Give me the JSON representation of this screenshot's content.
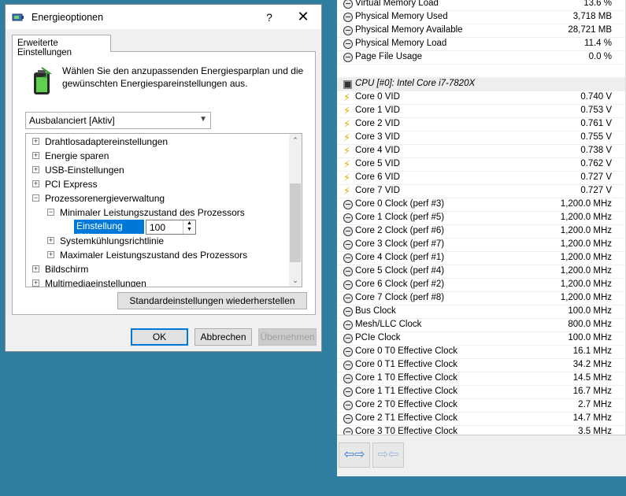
{
  "dialog": {
    "title": "Energieoptionen",
    "help_glyph": "?",
    "close_glyph": "✕",
    "tab_label": "Erweiterte Einstellungen",
    "description": "Wählen Sie den anzupassenden Energiesparplan und die gewünschten Energiespareinstellungen aus.",
    "plan_selected": "Ausbalanciert [Aktiv]",
    "tree": {
      "items": [
        {
          "label": "Drahtlosadaptereinstellungen",
          "expander": "+"
        },
        {
          "label": "Energie sparen",
          "expander": "+"
        },
        {
          "label": "USB-Einstellungen",
          "expander": "+"
        },
        {
          "label": "PCI Express",
          "expander": "+"
        },
        {
          "label": "Prozessorenergieverwaltung",
          "expander": "−"
        },
        {
          "label": "Minimaler Leistungszustand des Prozessors",
          "expander": "−"
        },
        {
          "label": "Systemkühlungsrichtlinie",
          "expander": "+"
        },
        {
          "label": "Maximaler Leistungszustand des Prozessors",
          "expander": "+"
        },
        {
          "label": "Bildschirm",
          "expander": "+"
        },
        {
          "label": "Multimediaeinstellungen",
          "expander": "+"
        }
      ],
      "setting_label": "Einstellung (%):",
      "setting_value": "100"
    },
    "restore_button": "Standardeinstellungen wiederherstellen",
    "ok_button": "OK",
    "cancel_button": "Abbrechen",
    "apply_button": "Übernehmen"
  },
  "sensors": {
    "rows": [
      {
        "icon": "clock",
        "name": "Virtual Memory Load",
        "value": "13.6 %"
      },
      {
        "icon": "clock",
        "name": "Physical Memory Used",
        "value": "3,718 MB"
      },
      {
        "icon": "clock",
        "name": "Physical Memory Available",
        "value": "28,721 MB"
      },
      {
        "icon": "clock",
        "name": "Physical Memory Load",
        "value": "11.4 %"
      },
      {
        "icon": "clock",
        "name": "Page File Usage",
        "value": "0.0 %"
      },
      {
        "icon": "blank",
        "name": "",
        "value": ""
      },
      {
        "icon": "cpu",
        "name": "CPU [#0]: Intel Core i7-7820X",
        "value": ""
      },
      {
        "icon": "volt",
        "name": "Core 0 VID",
        "value": "0.740 V"
      },
      {
        "icon": "volt",
        "name": "Core 1 VID",
        "value": "0.753 V"
      },
      {
        "icon": "volt",
        "name": "Core 2 VID",
        "value": "0.761 V"
      },
      {
        "icon": "volt",
        "name": "Core 3 VID",
        "value": "0.755 V"
      },
      {
        "icon": "volt",
        "name": "Core 4 VID",
        "value": "0.738 V"
      },
      {
        "icon": "volt",
        "name": "Core 5 VID",
        "value": "0.762 V"
      },
      {
        "icon": "volt",
        "name": "Core 6 VID",
        "value": "0.727 V"
      },
      {
        "icon": "volt",
        "name": "Core 7 VID",
        "value": "0.727 V"
      },
      {
        "icon": "clock",
        "name": "Core 0 Clock (perf #3)",
        "value": "1,200.0 MHz"
      },
      {
        "icon": "clock",
        "name": "Core 1 Clock (perf #5)",
        "value": "1,200.0 MHz"
      },
      {
        "icon": "clock",
        "name": "Core 2 Clock (perf #6)",
        "value": "1,200.0 MHz"
      },
      {
        "icon": "clock",
        "name": "Core 3 Clock (perf #7)",
        "value": "1,200.0 MHz"
      },
      {
        "icon": "clock",
        "name": "Core 4 Clock (perf #1)",
        "value": "1,200.0 MHz"
      },
      {
        "icon": "clock",
        "name": "Core 5 Clock (perf #4)",
        "value": "1,200.0 MHz"
      },
      {
        "icon": "clock",
        "name": "Core 6 Clock (perf #2)",
        "value": "1,200.0 MHz"
      },
      {
        "icon": "clock",
        "name": "Core 7 Clock (perf #8)",
        "value": "1,200.0 MHz"
      },
      {
        "icon": "clock",
        "name": "Bus Clock",
        "value": "100.0 MHz"
      },
      {
        "icon": "clock",
        "name": "Mesh/LLC Clock",
        "value": "800.0 MHz"
      },
      {
        "icon": "clock",
        "name": "PCIe Clock",
        "value": "100.0 MHz"
      },
      {
        "icon": "clock",
        "name": "Core 0 T0 Effective Clock",
        "value": "16.1 MHz"
      },
      {
        "icon": "clock",
        "name": "Core 0 T1 Effective Clock",
        "value": "34.2 MHz"
      },
      {
        "icon": "clock",
        "name": "Core 1 T0 Effective Clock",
        "value": "14.5 MHz"
      },
      {
        "icon": "clock",
        "name": "Core 1 T1 Effective Clock",
        "value": "16.7 MHz"
      },
      {
        "icon": "clock",
        "name": "Core 2 T0 Effective Clock",
        "value": "2.7 MHz"
      },
      {
        "icon": "clock",
        "name": "Core 2 T1 Effective Clock",
        "value": "14.7 MHz"
      },
      {
        "icon": "clock",
        "name": "Core 3 T0 Effective Clock",
        "value": "3.5 MHz"
      }
    ],
    "nav_left_glyph": "⇦⇨",
    "nav_right_glyph": "⇨⇦"
  }
}
